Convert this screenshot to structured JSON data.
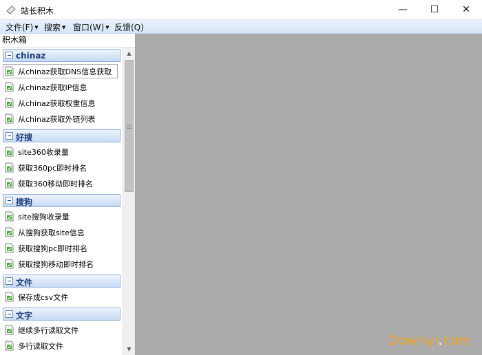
{
  "window": {
    "title": "站长积木",
    "icons": {
      "app": "eraser-icon",
      "minimize": "minimize-icon",
      "maximize": "maximize-icon",
      "close": "close-icon"
    },
    "minimize_glyph": "—",
    "maximize_glyph": "☐",
    "close_glyph": "✕"
  },
  "menu": {
    "file": "文件(F)",
    "search": "搜索",
    "window": "窗口(W)",
    "feedback": "反馈(Q)"
  },
  "panel": {
    "title": "积木箱",
    "groups": [
      {
        "label": "chinaz",
        "items": [
          "从chinaz获取DNS信息获取",
          "从chinaz获取IP信息",
          "从chinaz获取权重信息",
          "从chinaz获取外链列表"
        ]
      },
      {
        "label": "好搜",
        "items": [
          "site360收录量",
          "获取360pc即时排名",
          "获取360移动即时排名"
        ]
      },
      {
        "label": "搜狗",
        "items": [
          "site搜狗收录量",
          "从搜狗获取site信息",
          "获取搜狗pc即时排名",
          "获取搜狗移动即时排名"
        ]
      },
      {
        "label": "文件",
        "items": [
          "保存成csv文件"
        ]
      },
      {
        "label": "文字",
        "items": [
          "继续多行读取文件",
          "多行读取文件"
        ]
      }
    ],
    "selected_item": "从chinaz获取DNS信息获取"
  },
  "watermark": {
    "text_main": "Downyi",
    "text_dot": ".",
    "text_tld": "com"
  },
  "colors": {
    "workspace": "#ababab",
    "menubar": "#d6e5f7",
    "group_text": "#1b3d7a",
    "watermark": "#f0a126"
  }
}
